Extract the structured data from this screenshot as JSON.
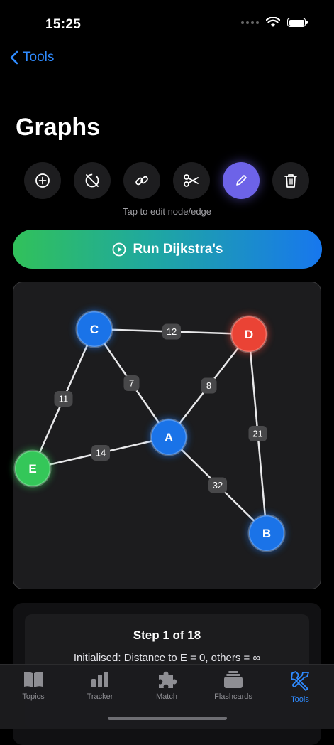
{
  "status": {
    "time": "15:25"
  },
  "nav": {
    "back_label": "Tools"
  },
  "page": {
    "title": "Graphs"
  },
  "toolbar": {
    "hint": "Tap to edit node/edge",
    "tools": [
      {
        "name": "add-node",
        "icon": "plus-circle-icon",
        "active": false
      },
      {
        "name": "delete-node",
        "icon": "slashed-circle-icon",
        "active": false
      },
      {
        "name": "link-edge",
        "icon": "link-icon",
        "active": false
      },
      {
        "name": "cut-edge",
        "icon": "scissors-icon",
        "active": false
      },
      {
        "name": "edit",
        "icon": "pencil-icon",
        "active": true
      },
      {
        "name": "clear",
        "icon": "trash-icon",
        "active": false
      }
    ]
  },
  "run_button": {
    "label": "Run Dijkstra's"
  },
  "graph": {
    "nodes": [
      {
        "id": "C",
        "color": "#1a73e8",
        "state": "default"
      },
      {
        "id": "D",
        "color": "#ea4335",
        "state": "highlighted"
      },
      {
        "id": "A",
        "color": "#1a73e8",
        "state": "default"
      },
      {
        "id": "E",
        "color": "#34c759",
        "state": "source"
      },
      {
        "id": "B",
        "color": "#1a73e8",
        "state": "default"
      }
    ],
    "edges": [
      {
        "from": "C",
        "to": "D",
        "weight": "12"
      },
      {
        "from": "C",
        "to": "E",
        "weight": "11"
      },
      {
        "from": "C",
        "to": "A",
        "weight": "7"
      },
      {
        "from": "D",
        "to": "A",
        "weight": "8"
      },
      {
        "from": "D",
        "to": "B",
        "weight": "21"
      },
      {
        "from": "E",
        "to": "A",
        "weight": "14"
      },
      {
        "from": "A",
        "to": "B",
        "weight": "32"
      }
    ]
  },
  "step": {
    "title": "Step 1 of 18",
    "description": "Initialised: Distance to E = 0, others = ∞"
  },
  "tabs": [
    {
      "label": "Topics",
      "icon": "book-icon",
      "active": false
    },
    {
      "label": "Tracker",
      "icon": "bar-chart-icon",
      "active": false
    },
    {
      "label": "Match",
      "icon": "puzzle-icon",
      "active": false
    },
    {
      "label": "Flashcards",
      "icon": "cards-stack-icon",
      "active": false
    },
    {
      "label": "Tools",
      "icon": "tools-icon",
      "active": true
    }
  ],
  "colors": {
    "accent": "#2f8bff",
    "active_tool": "#6d63e8"
  }
}
